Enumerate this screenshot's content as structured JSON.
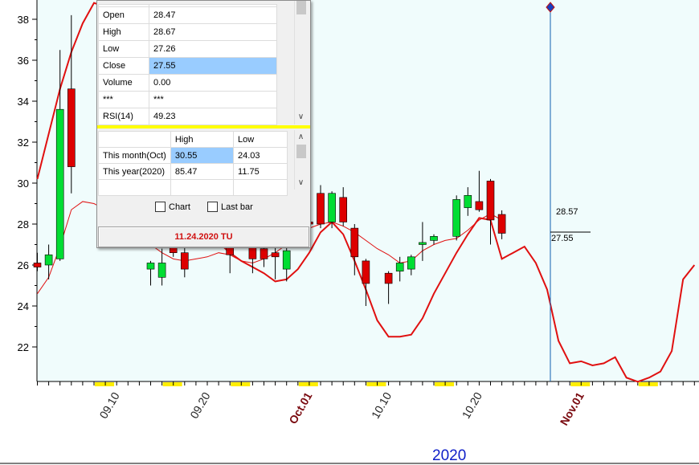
{
  "chart_data": {
    "type": "candlestick",
    "y_axis": {
      "ticks": [
        22,
        24,
        26,
        28,
        30,
        32,
        34,
        36,
        38
      ],
      "range": [
        20.3,
        38.9
      ]
    },
    "x_axis": {
      "date_labels": [
        {
          "label": "09.10",
          "index": 7
        },
        {
          "label": "09.20",
          "index": 15
        },
        {
          "label": "Oct.01",
          "index": 24,
          "month": true
        },
        {
          "label": "10.10",
          "index": 31
        },
        {
          "label": "10.20",
          "index": 39
        },
        {
          "label": "Nov.01",
          "index": 48,
          "month": true
        }
      ],
      "year_label": "2020"
    },
    "candles": [
      {
        "i": 0,
        "o": 26.1,
        "h": 26.6,
        "l": 25.7,
        "c": 25.9
      },
      {
        "i": 1,
        "o": 26.0,
        "h": 27.0,
        "l": 25.3,
        "c": 26.5
      },
      {
        "i": 2,
        "o": 26.3,
        "h": 36.5,
        "l": 26.2,
        "c": 33.6
      },
      {
        "i": 3,
        "o": 34.6,
        "h": 38.2,
        "l": 29.5,
        "c": 30.8
      },
      {
        "i": 10,
        "o": 25.8,
        "h": 26.2,
        "l": 25.0,
        "c": 26.1
      },
      {
        "i": 11,
        "o": 25.4,
        "h": 26.8,
        "l": 25.0,
        "c": 26.1
      },
      {
        "i": 12,
        "o": 27.0,
        "h": 27.5,
        "l": 26.4,
        "c": 26.6
      },
      {
        "i": 13,
        "o": 26.6,
        "h": 27.1,
        "l": 25.4,
        "c": 25.8
      },
      {
        "i": 17,
        "o": 26.9,
        "h": 28.5,
        "l": 25.6,
        "c": 26.5
      },
      {
        "i": 19,
        "o": 27.0,
        "h": 27.3,
        "l": 25.6,
        "c": 26.3
      },
      {
        "i": 20,
        "o": 26.8,
        "h": 27.2,
        "l": 25.9,
        "c": 26.3
      },
      {
        "i": 21,
        "o": 26.6,
        "h": 27.1,
        "l": 25.3,
        "c": 26.4
      },
      {
        "i": 22,
        "o": 25.8,
        "h": 27.0,
        "l": 25.2,
        "c": 26.7
      },
      {
        "i": 23,
        "o": 28.8,
        "h": 29.5,
        "l": 27.5,
        "c": 27.6
      },
      {
        "i": 24,
        "o": 28.1,
        "h": 29.6,
        "l": 27.2,
        "c": 28.0
      },
      {
        "i": 25,
        "o": 29.5,
        "h": 29.9,
        "l": 27.8,
        "c": 28.0
      },
      {
        "i": 26,
        "o": 28.1,
        "h": 29.6,
        "l": 27.8,
        "c": 29.5
      },
      {
        "i": 27,
        "o": 29.3,
        "h": 29.8,
        "l": 27.9,
        "c": 28.1
      },
      {
        "i": 28,
        "o": 27.8,
        "h": 28.0,
        "l": 25.5,
        "c": 26.4
      },
      {
        "i": 29,
        "o": 26.2,
        "h": 26.3,
        "l": 24.0,
        "c": 25.1
      },
      {
        "i": 31,
        "o": 25.6,
        "h": 25.7,
        "l": 24.1,
        "c": 25.1
      },
      {
        "i": 32,
        "o": 25.7,
        "h": 26.4,
        "l": 25.2,
        "c": 26.1
      },
      {
        "i": 33,
        "o": 25.8,
        "h": 26.5,
        "l": 25.5,
        "c": 26.4
      },
      {
        "i": 34,
        "o": 27.0,
        "h": 28.1,
        "l": 26.2,
        "c": 27.1
      },
      {
        "i": 35,
        "o": 27.2,
        "h": 27.5,
        "l": 27.0,
        "c": 27.4
      },
      {
        "i": 37,
        "o": 27.4,
        "h": 29.4,
        "l": 27.2,
        "c": 29.2
      },
      {
        "i": 38,
        "o": 28.8,
        "h": 29.8,
        "l": 28.4,
        "c": 29.4
      },
      {
        "i": 39,
        "o": 29.1,
        "h": 30.6,
        "l": 28.6,
        "c": 28.7
      },
      {
        "i": 40,
        "o": 30.1,
        "h": 30.2,
        "l": 27.0,
        "c": 28.2
      },
      {
        "i": 41,
        "o": 28.47,
        "h": 28.67,
        "l": 27.26,
        "c": 27.55
      }
    ],
    "moving_average": [
      [
        0,
        24.6
      ],
      [
        1,
        25.4
      ],
      [
        2,
        26.9
      ],
      [
        3,
        28.7
      ],
      [
        4,
        29.1
      ],
      [
        5,
        29.0
      ],
      [
        6,
        28.7
      ],
      [
        7,
        28.3
      ],
      [
        8,
        27.9
      ],
      [
        9,
        27.5
      ],
      [
        10,
        27.0
      ],
      [
        11,
        26.6
      ],
      [
        12,
        26.3
      ],
      [
        13,
        26.2
      ],
      [
        14,
        26.3
      ],
      [
        15,
        26.4
      ],
      [
        16,
        26.6
      ],
      [
        17,
        26.5
      ],
      [
        18,
        26.2
      ],
      [
        19,
        26.1
      ],
      [
        20,
        26.3
      ],
      [
        21,
        26.6
      ],
      [
        22,
        27.0
      ],
      [
        23,
        27.4
      ],
      [
        24,
        27.8
      ],
      [
        25,
        28.0
      ],
      [
        26,
        28.1
      ],
      [
        27,
        27.9
      ],
      [
        28,
        27.6
      ],
      [
        29,
        27.2
      ],
      [
        30,
        26.8
      ],
      [
        31,
        26.5
      ],
      [
        32,
        26.1
      ],
      [
        33,
        26.2
      ],
      [
        34,
        26.7
      ],
      [
        35,
        27.0
      ],
      [
        36,
        27.2
      ],
      [
        37,
        27.3
      ],
      [
        38,
        27.7
      ],
      [
        39,
        28.2
      ],
      [
        40,
        28.5
      ],
      [
        41,
        28.2
      ]
    ],
    "forecast_line": [
      [
        0,
        30.2
      ],
      [
        1,
        32.4
      ],
      [
        2,
        34.6
      ],
      [
        3,
        36.4
      ],
      [
        4,
        37.8
      ],
      [
        5,
        38.8
      ],
      [
        6,
        38.6
      ],
      [
        7,
        37.7
      ],
      [
        8,
        36.2
      ],
      [
        9,
        34.6
      ],
      [
        10,
        33.0
      ],
      [
        11,
        31.6
      ],
      [
        12,
        30.3
      ],
      [
        13,
        29.2
      ],
      [
        14,
        28.3
      ],
      [
        15,
        27.6
      ],
      [
        16,
        27.1
      ],
      [
        17,
        26.6
      ],
      [
        18,
        26.2
      ],
      [
        19,
        25.9
      ],
      [
        20,
        25.6
      ],
      [
        21,
        25.2
      ],
      [
        22,
        25.3
      ],
      [
        23,
        25.8
      ],
      [
        24,
        26.6
      ],
      [
        25,
        27.6
      ],
      [
        26,
        28.1
      ],
      [
        27,
        27.5
      ],
      [
        28,
        26.2
      ],
      [
        29,
        24.8
      ],
      [
        30,
        23.3
      ],
      [
        31,
        22.5
      ],
      [
        32,
        22.5
      ],
      [
        33,
        22.6
      ],
      [
        34,
        23.4
      ],
      [
        35,
        24.6
      ],
      [
        36,
        25.6
      ],
      [
        37,
        26.6
      ],
      [
        38,
        27.5
      ],
      [
        39,
        28.3
      ],
      [
        40,
        28.2
      ],
      [
        41,
        26.3
      ],
      [
        42,
        26.6
      ],
      [
        43,
        26.9
      ],
      [
        44,
        26.1
      ],
      [
        45,
        24.8
      ],
      [
        46,
        22.3
      ],
      [
        47,
        21.2
      ],
      [
        48,
        21.3
      ],
      [
        49,
        21.1
      ],
      [
        50,
        21.2
      ],
      [
        51,
        21.5
      ],
      [
        52,
        20.5
      ],
      [
        53,
        20.3
      ],
      [
        54,
        20.5
      ],
      [
        55,
        20.8
      ],
      [
        56,
        21.8
      ],
      [
        57,
        25.3
      ],
      [
        58,
        26.0
      ]
    ],
    "current_price_labels": {
      "upper": "28.57",
      "lower": "27.55"
    },
    "colors": {
      "up": "#00dd33",
      "down": "#dd0000",
      "ma": "#e01010",
      "forecast": "#e01010",
      "background": "#f0fcfc",
      "marker": "#ffee00",
      "cursor": "#1060b0"
    }
  },
  "panel": {
    "quote_rows": [
      {
        "label": "",
        "value": ""
      },
      {
        "label": "Open",
        "value": "28.47"
      },
      {
        "label": "High",
        "value": "28.67"
      },
      {
        "label": "Low",
        "value": "27.26"
      },
      {
        "label": "Close",
        "value": "27.55"
      },
      {
        "label": "Volume",
        "value": "0.00"
      },
      {
        "label": "***",
        "value": "***"
      },
      {
        "label": "RSI(14)",
        "value": "49.23"
      }
    ],
    "hl_header": {
      "col1": "High",
      "col2": "Low"
    },
    "hl_rows": [
      {
        "label": "This month(Oct)",
        "high": "30.55",
        "low": "24.03"
      },
      {
        "label": "This year(2020)",
        "high": "85.47",
        "low": "11.75"
      }
    ],
    "chart_checkbox": "Chart",
    "lastbar_checkbox": "Last bar",
    "date_display": "11.24.2020 TU"
  }
}
